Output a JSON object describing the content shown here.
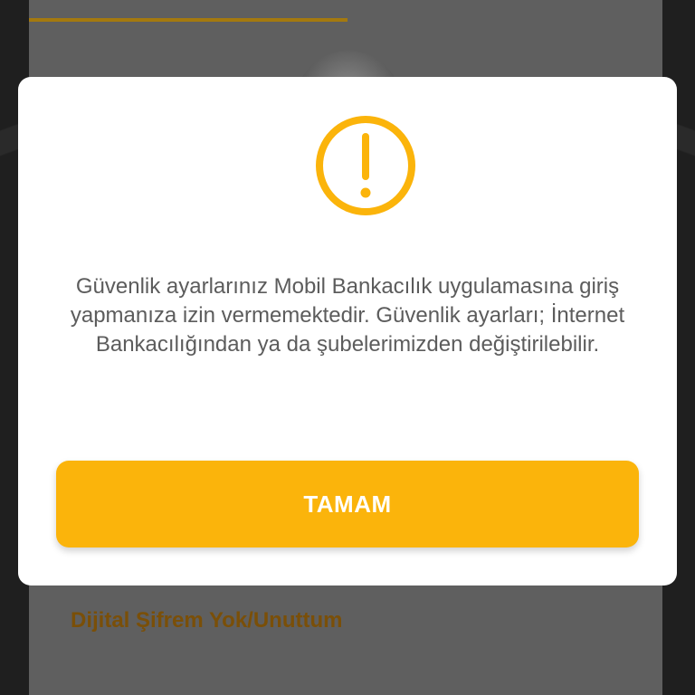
{
  "dialog": {
    "icon": "exclamation-circle-icon",
    "message": "Güvenlik ayarlarınız Mobil Bankacılık uygulamasına giriş yapmanıza izin vermemektedir. Güvenlik ayarları; İnternet Bankacılığından ya da şubelerimizden değiştirilebilir.",
    "ok_label": "TAMAM"
  },
  "background": {
    "forgot_link": "Dijital Şifrem Yok/Unuttum"
  },
  "colors": {
    "accent": "#fbb40b",
    "link": "#7a4f08"
  }
}
